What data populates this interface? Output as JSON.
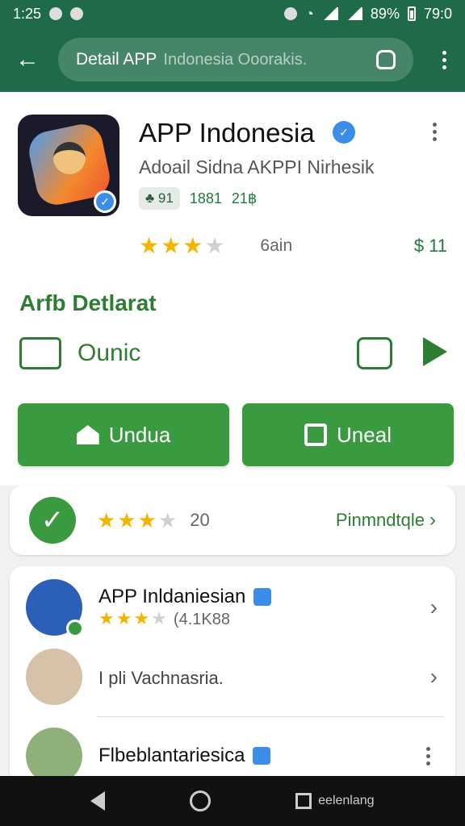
{
  "status": {
    "time": "1:25",
    "battery": "89%",
    "clock": "79:0"
  },
  "appbar": {
    "title": "Detail APP",
    "search_placeholder": "Indonesia Ooorakis."
  },
  "app": {
    "name": "APP Indonesia",
    "subtitle": "Adoail Sidna AKPPI Nirhesik",
    "chip": "91",
    "meta1": "1881",
    "meta2": "21฿",
    "rating_count": "6ain",
    "price": "$ 11",
    "rating_stars": 3.5
  },
  "section": {
    "title": "Arfb Detlarat",
    "info_label": "Ounic"
  },
  "buttons": {
    "download": "Undua",
    "install": "Uneal"
  },
  "summary": {
    "value": "20",
    "link": "Pinmndtqle"
  },
  "reviews": [
    {
      "name": "APP Inldaniesian",
      "count": "(4.1K88"
    },
    {
      "name": "I pli Vachnasria."
    },
    {
      "name": "Flbeblantariesica"
    }
  ],
  "navbar": {
    "recent_label": "eelenlang"
  }
}
